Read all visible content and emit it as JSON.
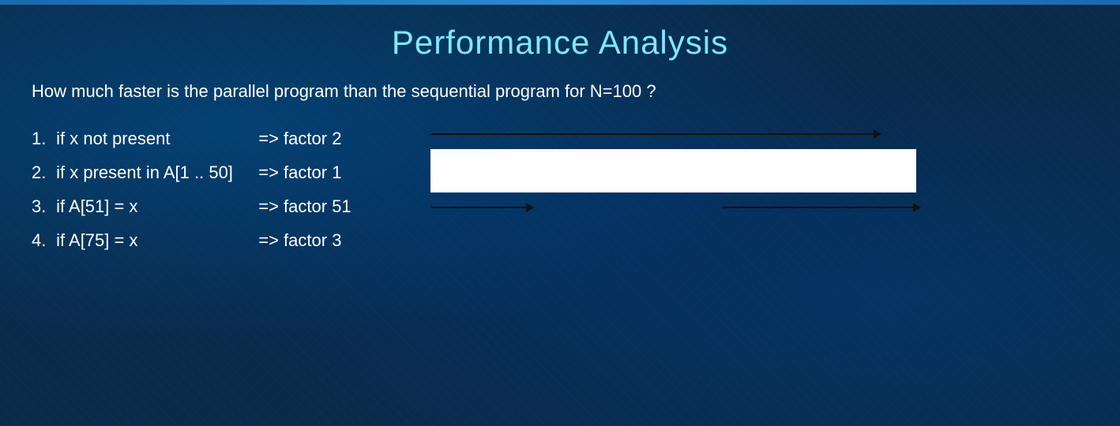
{
  "page": {
    "title": "Performance Analysis",
    "subtitle": "How much faster is the parallel program than the sequential program for N=100 ?",
    "top_bar_color": "#2a8ad0",
    "background_color": "#0a2a4a"
  },
  "list": {
    "items": [
      {
        "number": "1.",
        "condition": "if x not present",
        "arrow": "=>",
        "result": "factor 2"
      },
      {
        "number": "2.",
        "condition": "if x present in A[1 .. 50]",
        "arrow": "=>",
        "result": "factor 1"
      },
      {
        "number": "3.",
        "condition": "if A[51] = x",
        "arrow": "=>",
        "result": "factor 51"
      },
      {
        "number": "4.",
        "condition": "if A[75] = x",
        "arrow": "=>",
        "result": "factor 3"
      }
    ]
  },
  "diagram": {
    "top_arrow_width": 570,
    "array_cells": [
      {
        "type": "narrow",
        "label": ""
      },
      {
        "type": "wide",
        "label": ""
      },
      {
        "type": "narrow",
        "label": ""
      },
      {
        "type": "medium",
        "label": ""
      },
      {
        "type": "narrow",
        "label": ""
      },
      {
        "type": "narrow",
        "label": ""
      },
      {
        "type": "narrow",
        "label": ""
      }
    ],
    "bottom_arrows": [
      {
        "width": 130
      },
      {
        "width": 130
      }
    ]
  }
}
